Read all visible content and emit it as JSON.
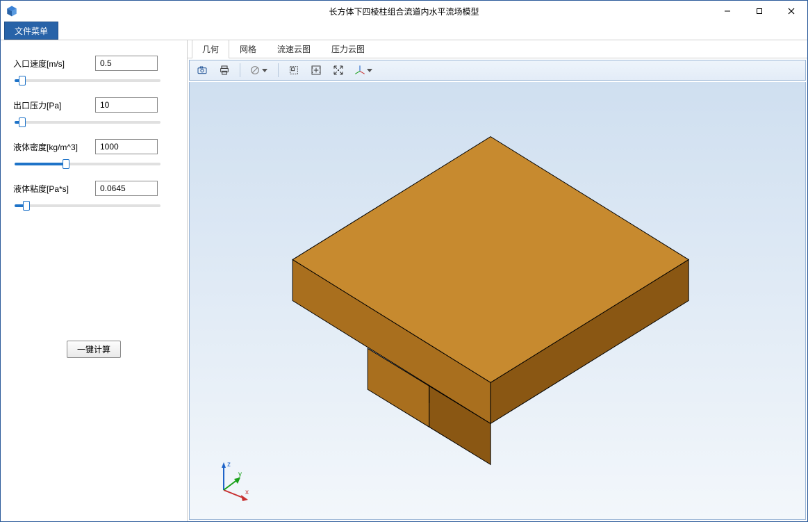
{
  "window": {
    "title": "长方体下四棱柱组合流道内水平流场模型"
  },
  "menubar": {
    "file_menu": "文件菜单"
  },
  "sidebar": {
    "params": [
      {
        "label": "入口速度[m/s]",
        "value": "0.5",
        "slider_pct": 5
      },
      {
        "label": "出口压力[Pa]",
        "value": "10",
        "slider_pct": 5
      },
      {
        "label": "液体密度[kg/m^3]",
        "value": "1000",
        "slider_pct": 35
      },
      {
        "label": "液体粘度[Pa*s]",
        "value": "0.0645",
        "slider_pct": 8
      }
    ],
    "compute_label": "一键计算"
  },
  "tabs": {
    "items": [
      "几何",
      "网格",
      "流速云图",
      "压力云图"
    ],
    "active_index": 0
  },
  "toolbar": {
    "icons": [
      "camera",
      "print",
      "forbidden",
      "zoom-box",
      "fit",
      "pick-rotate",
      "axes"
    ]
  },
  "triad": {
    "x": "x",
    "y": "y",
    "z": "z"
  },
  "colors": {
    "accent": "#2863a8",
    "model_top": "#c78a2f",
    "model_side_light": "#a96f1e",
    "model_side_dark": "#8a5713"
  }
}
